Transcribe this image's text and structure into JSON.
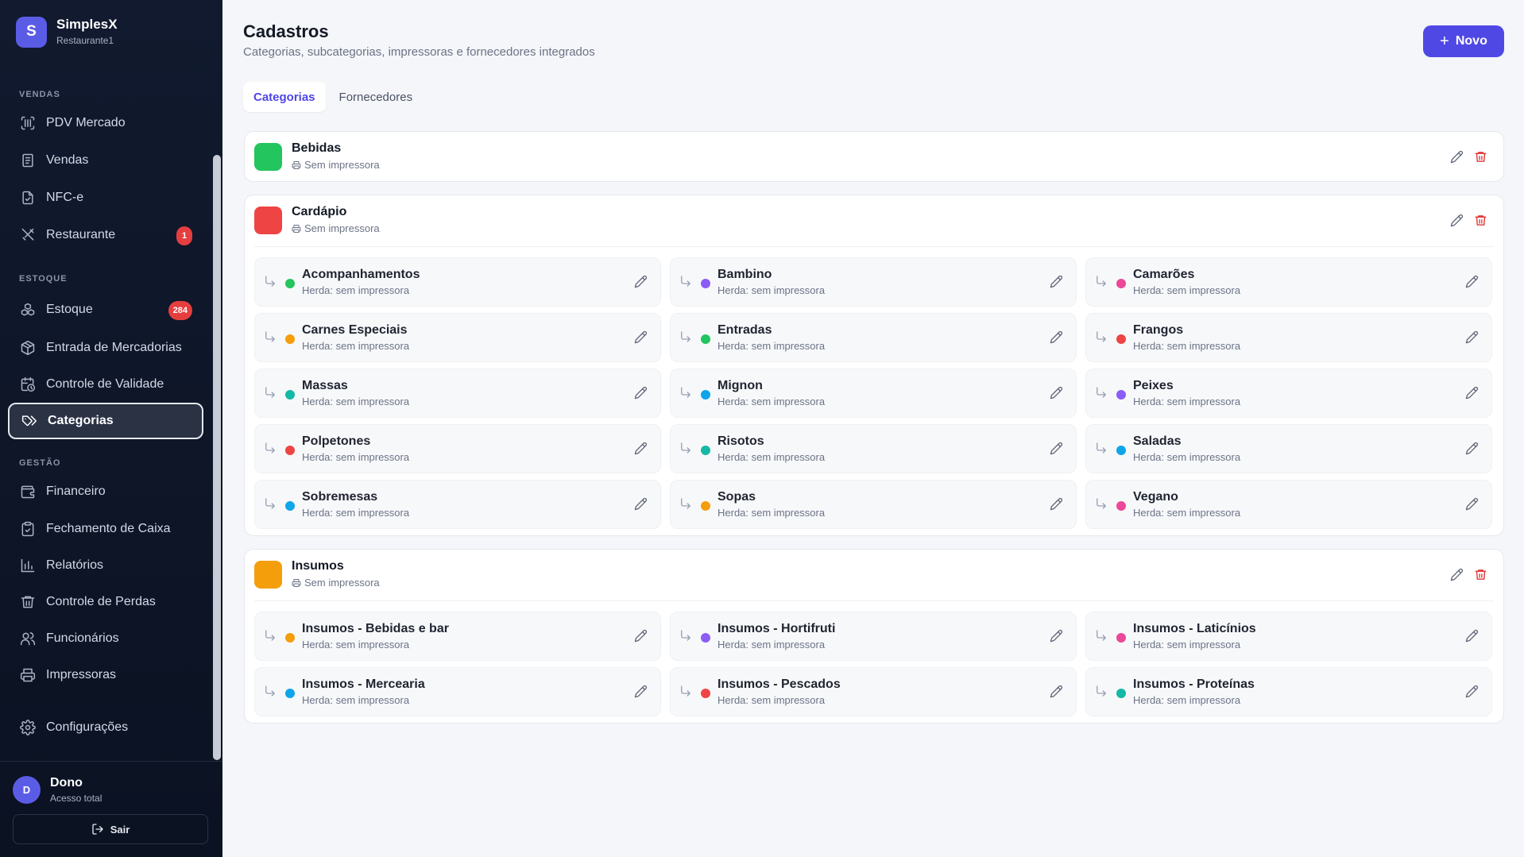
{
  "brand": {
    "initial": "S",
    "name": "SimplesX",
    "subtitle": "Restaurante1"
  },
  "sidebar": {
    "sections": {
      "vendas": "VENDAS",
      "estoque": "ESTOQUE",
      "gestao": "GESTÃO"
    },
    "items": [
      {
        "label": "PDV Mercado",
        "icon": "barcode-icon"
      },
      {
        "label": "Vendas",
        "icon": "receipt-icon"
      },
      {
        "label": "NFC-e",
        "icon": "file-icon"
      },
      {
        "label": "Restaurante",
        "icon": "utensils-icon",
        "badge": "1"
      },
      {
        "label": "Estoque",
        "icon": "boxes-icon",
        "badge": "284"
      },
      {
        "label": "Entrada de Mercadorias",
        "icon": "package-icon"
      },
      {
        "label": "Controle de Validade",
        "icon": "calendar-clock-icon"
      },
      {
        "label": "Categorias",
        "icon": "tags-icon",
        "active": true
      },
      {
        "label": "Financeiro",
        "icon": "wallet-icon"
      },
      {
        "label": "Fechamento de Caixa",
        "icon": "clipboard-check-icon"
      },
      {
        "label": "Relatórios",
        "icon": "bar-chart-icon"
      },
      {
        "label": "Controle de Perdas",
        "icon": "trash-icon"
      },
      {
        "label": "Funcionários",
        "icon": "users-icon"
      },
      {
        "label": "Impressoras",
        "icon": "printer-icon"
      },
      {
        "label": "Configurações",
        "icon": "gear-icon"
      }
    ],
    "user": {
      "initial": "D",
      "name": "Dono",
      "role": "Acesso total"
    },
    "logout_label": "Sair"
  },
  "header": {
    "title": "Cadastros",
    "subtitle": "Categorias, subcategorias, impressoras e fornecedores integrados",
    "new_button": "Novo"
  },
  "tabs": [
    {
      "label": "Categorias",
      "active": true
    },
    {
      "label": "Fornecedores",
      "active": false
    }
  ],
  "categories": [
    {
      "name": "Bebidas",
      "color": "#22c55e",
      "printer": "Sem impressora",
      "subcategories": []
    },
    {
      "name": "Cardápio",
      "color": "#ef4444",
      "printer": "Sem impressora",
      "subcategories": [
        {
          "name": "Acompanhamentos",
          "color": "#22c55e",
          "info": "Herda: sem impressora"
        },
        {
          "name": "Bambino",
          "color": "#8b5cf6",
          "info": "Herda: sem impressora"
        },
        {
          "name": "Camarões",
          "color": "#ec4899",
          "info": "Herda: sem impressora"
        },
        {
          "name": "Carnes Especiais",
          "color": "#f59e0b",
          "info": "Herda: sem impressora"
        },
        {
          "name": "Entradas",
          "color": "#22c55e",
          "info": "Herda: sem impressora"
        },
        {
          "name": "Frangos",
          "color": "#ef4444",
          "info": "Herda: sem impressora"
        },
        {
          "name": "Massas",
          "color": "#14b8a6",
          "info": "Herda: sem impressora"
        },
        {
          "name": "Mignon",
          "color": "#0ea5e9",
          "info": "Herda: sem impressora"
        },
        {
          "name": "Peixes",
          "color": "#8b5cf6",
          "info": "Herda: sem impressora"
        },
        {
          "name": "Polpetones",
          "color": "#ef4444",
          "info": "Herda: sem impressora"
        },
        {
          "name": "Risotos",
          "color": "#14b8a6",
          "info": "Herda: sem impressora"
        },
        {
          "name": "Saladas",
          "color": "#0ea5e9",
          "info": "Herda: sem impressora"
        },
        {
          "name": "Sobremesas",
          "color": "#0ea5e9",
          "info": "Herda: sem impressora"
        },
        {
          "name": "Sopas",
          "color": "#f59e0b",
          "info": "Herda: sem impressora"
        },
        {
          "name": "Vegano",
          "color": "#ec4899",
          "info": "Herda: sem impressora"
        }
      ]
    },
    {
      "name": "Insumos",
      "color": "#f59e0b",
      "printer": "Sem impressora",
      "subcategories": [
        {
          "name": "Insumos - Bebidas e bar",
          "color": "#f59e0b",
          "info": "Herda: sem impressora"
        },
        {
          "name": "Insumos - Hortifruti",
          "color": "#8b5cf6",
          "info": "Herda: sem impressora"
        },
        {
          "name": "Insumos - Laticínios",
          "color": "#ec4899",
          "info": "Herda: sem impressora"
        },
        {
          "name": "Insumos - Mercearia",
          "color": "#0ea5e9",
          "info": "Herda: sem impressora"
        },
        {
          "name": "Insumos - Pescados",
          "color": "#ef4444",
          "info": "Herda: sem impressora"
        },
        {
          "name": "Insumos - Proteínas",
          "color": "#14b8a6",
          "info": "Herda: sem impressora"
        }
      ]
    }
  ]
}
